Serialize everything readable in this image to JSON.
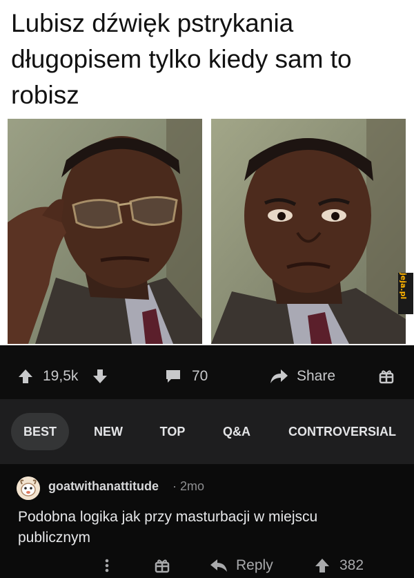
{
  "caption": "Lubisz dźwięk pstrykania długopisem tylko kiedy sam to robisz",
  "watermark": "jeja.pl",
  "post_actions": {
    "vote_count": "19,5k",
    "comment_count": "70",
    "share_label": "Share"
  },
  "sort_tabs": [
    {
      "label": "BEST",
      "active": true
    },
    {
      "label": "NEW",
      "active": false
    },
    {
      "label": "TOP",
      "active": false
    },
    {
      "label": "Q&A",
      "active": false
    },
    {
      "label": "CONTROVERSIAL",
      "active": false
    }
  ],
  "comment": {
    "author": "goatwithanattitude",
    "separator": "·",
    "time": "2mo",
    "body": "Podobna logika jak przy masturbacji w miejscu publicznym",
    "reply_label": "Reply",
    "vote_count": "382"
  },
  "colors": {
    "dark_bg": "#0b0b0b",
    "sort_bar_bg": "#1e1e1f",
    "active_tab_bg": "#343536",
    "text_light": "#e4e5e7",
    "watermark_text": "#ffb400"
  },
  "icons": [
    "upvote-icon",
    "downvote-icon",
    "comment-icon",
    "share-icon",
    "award-icon",
    "more-icon",
    "reply-icon"
  ]
}
